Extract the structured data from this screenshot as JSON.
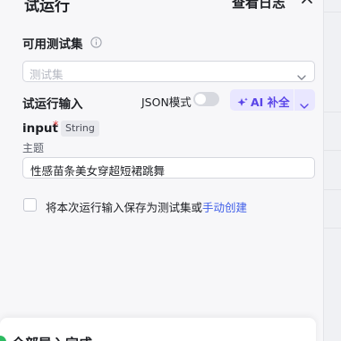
{
  "header": {
    "title": "试运行",
    "view_log": "查看日志"
  },
  "test_set": {
    "label": "可用测试集",
    "placeholder": "测试集"
  },
  "run_input": {
    "label": "试运行输入",
    "json_mode_label": "JSON模式",
    "json_mode_on": false,
    "ai_fill_label": "AI 补全"
  },
  "field": {
    "name": "input",
    "required_mark": "*",
    "type": "String",
    "description": "主题",
    "value": "性感苗条美女穿超短裙跳舞"
  },
  "save_option": {
    "text": "将本次运行输入保存为测试集或",
    "link": "手动创建",
    "checked": false
  },
  "bottom_panel": {
    "label": "全部导入完成"
  },
  "colors": {
    "accent": "#5a45e8",
    "ai_button_bg": "#e9e7ff",
    "link": "#3f5ee8",
    "required": "#e04444",
    "success": "#2dbb61"
  },
  "icons": [
    "close-icon",
    "info-icon",
    "chevron-down-icon",
    "sparkle-icon"
  ]
}
